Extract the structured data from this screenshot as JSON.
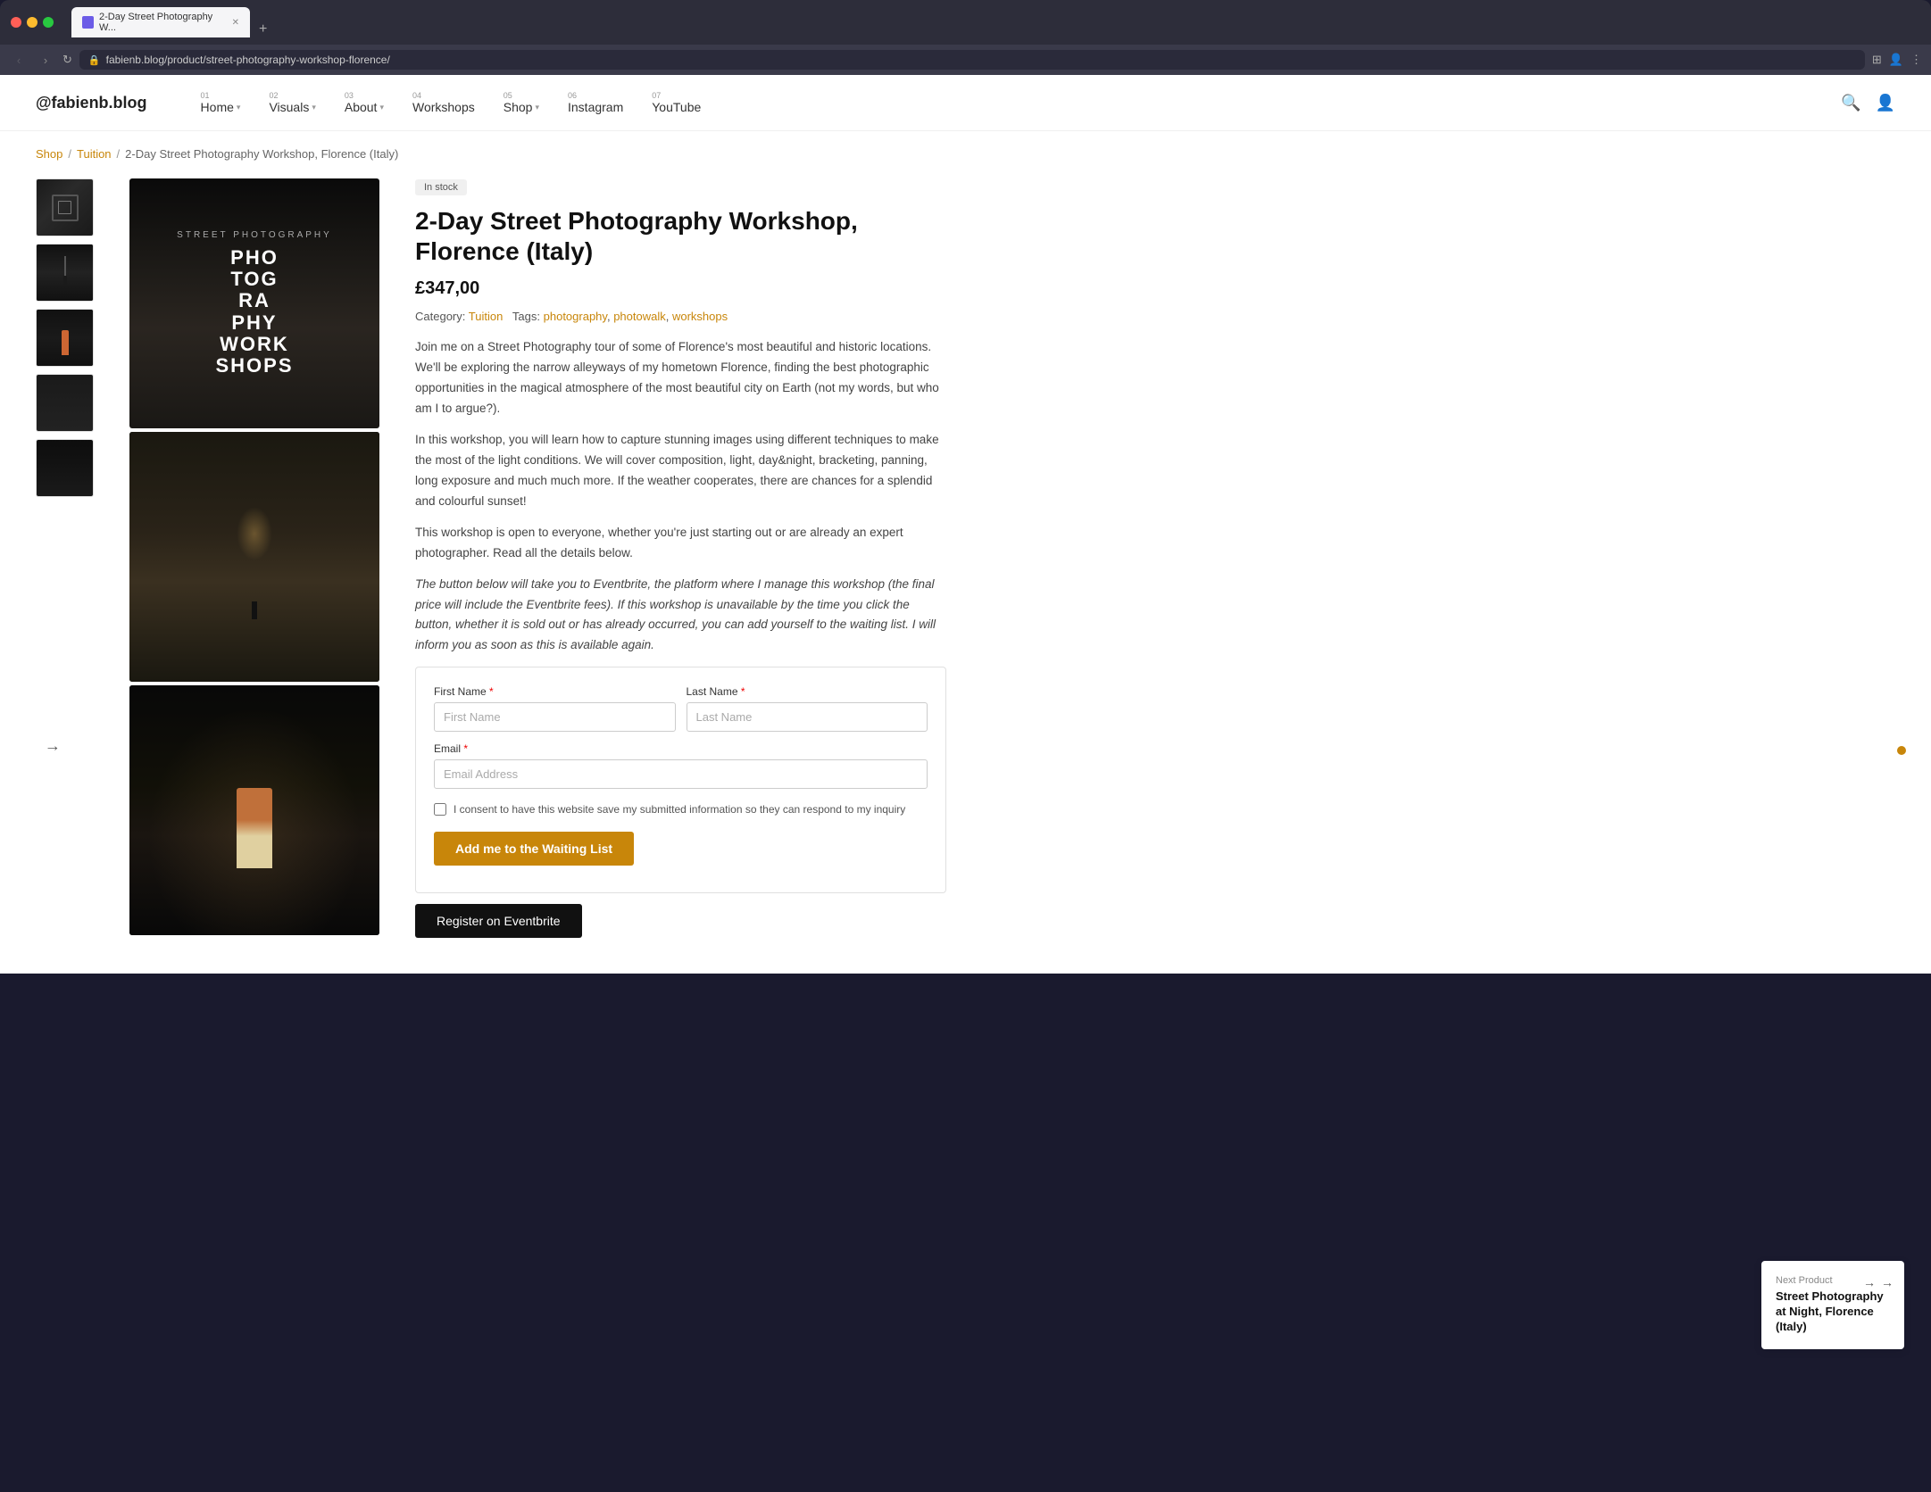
{
  "browser": {
    "tab_title": "2-Day Street Photography W...",
    "url_display": "fabienb.blog/product/street-photography-workshop-florence/",
    "new_tab_label": "+"
  },
  "nav": {
    "logo": "@fabienb.blog",
    "items": [
      {
        "num": "01",
        "label": "Home",
        "has_dropdown": true
      },
      {
        "num": "02",
        "label": "Visuals",
        "has_dropdown": true
      },
      {
        "num": "03",
        "label": "About",
        "has_dropdown": true
      },
      {
        "num": "04",
        "label": "Workshops",
        "has_dropdown": false
      },
      {
        "num": "05",
        "label": "Shop",
        "has_dropdown": true
      },
      {
        "num": "06",
        "label": "Instagram",
        "has_dropdown": false
      },
      {
        "num": "07",
        "label": "YouTube",
        "has_dropdown": false
      }
    ]
  },
  "breadcrumb": {
    "items": [
      "Shop",
      "Tuition",
      "2-Day Street Photography Workshop, Florence (Italy)"
    ]
  },
  "product": {
    "stock_status": "In stock",
    "title": "2-Day Street Photography Workshop, Florence (Italy)",
    "price": "£347,00",
    "category_label": "Category:",
    "category": "Tuition",
    "tags_label": "Tags:",
    "tags": [
      "photography",
      "photowalk",
      "workshops"
    ],
    "description_1": "Join me on a Street Photography tour of some of Florence's most beautiful and historic locations. We'll be exploring the narrow alleyways of my hometown Florence, finding the best photographic opportunities in the magical atmosphere of the most beautiful city on Earth (not my words, but who am I to argue?).",
    "description_2": "In this workshop, you will learn how to capture stunning images using different techniques to make the most of the light conditions. We will cover composition, light, day&night, bracketing, panning, long exposure and much much more. If the weather cooperates, there are chances for a splendid and colourful sunset!",
    "description_3": "This workshop is open to everyone, whether you're just starting out or are already an expert photographer. Read all the details below.",
    "description_italic": "The button below will take you to Eventbrite, the platform where I manage this workshop (the final price will include the Eventbrite fees). If this workshop is unavailable by the time you click the button, whether it is sold out or has already occurred, you can add yourself to the waiting list. I will inform you as soon as this is available again."
  },
  "form": {
    "first_name_label": "First Name",
    "last_name_label": "Last Name",
    "email_label": "Email",
    "first_name_placeholder": "First Name",
    "last_name_placeholder": "Last Name",
    "email_placeholder": "Email Address",
    "required_marker": "*",
    "consent_text": "I consent to have this website save my submitted information so they can respond to my inquiry",
    "waiting_list_btn": "Add me to the Waiting List",
    "eventbrite_btn": "Register on Eventbrite"
  },
  "next_product": {
    "label": "Next Product",
    "title": "Street Photography at Night, Florence (Italy)"
  },
  "workshop_text": {
    "pre": "STREET PHOTOGRAPHY",
    "line1": "PHO",
    "line2": "TOG",
    "line3": "RA",
    "line4": "PHY",
    "line5": "WORK",
    "line6": "SHOPS"
  }
}
